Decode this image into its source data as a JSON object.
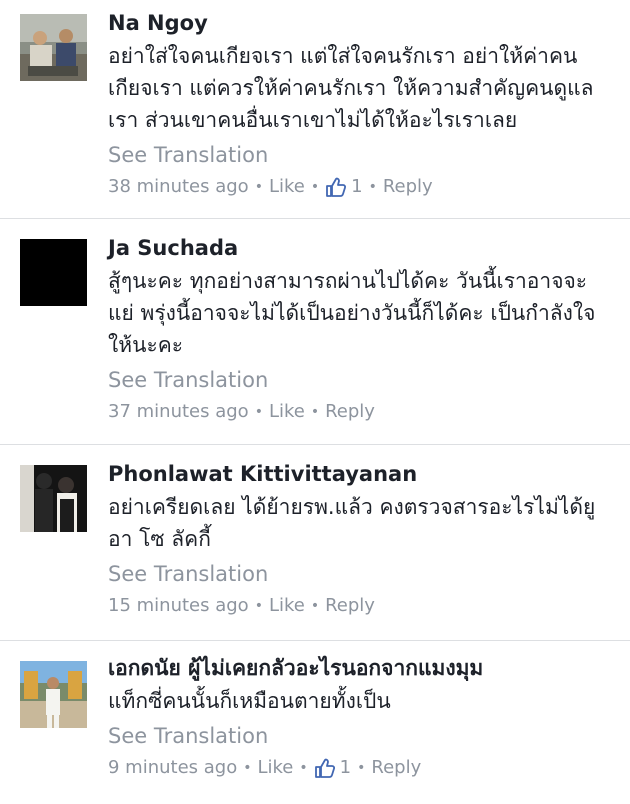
{
  "comments": [
    {
      "name": "Na Ngoy",
      "text": "อย่าใส่ใจคนเกียจเรา แต่ใส่ใจคนรักเรา อย่าให้ค่าคนเกียจเรา แต่ควรให้ค่าคนรักเรา ให้ความสำคัญคนดูแลเรา ส่วนเขาคนอื่นเราเขาไม่ได้ให้อะไรเราเลย",
      "see_translation": "See Translation",
      "time": "38 minutes ago",
      "like": "Like",
      "like_count": "1",
      "reply": "Reply"
    },
    {
      "name": "Ja Suchada",
      "text": "สู้ๆนะคะ ทุกอย่างสามารถผ่านไปได้คะ วันนี้เราอาจจะแย่ พรุ่งนี้อาจจะไม่ได้เป็นอย่างวันนี้ก็ได้คะ เป็นกำลังใจให้นะคะ",
      "see_translation": "See Translation",
      "time": "37 minutes ago",
      "like": "Like",
      "reply": "Reply"
    },
    {
      "name": "Phonlawat Kittivittayanan",
      "text": "อย่าเครียดเลย ได้ย้ายรพ.แล้ว คงตรวจสารอะไรไม่ได้ยู อา โซ ลัคกี้",
      "see_translation": "See Translation",
      "time": "15 minutes ago",
      "like": "Like",
      "reply": "Reply"
    },
    {
      "name": "เอกดนัย ผู้ไม่เคยกลัวอะไรนอกจากแมงมุม",
      "text": "แท็กซี่คนนั้นก็เหมือนตายทั้งเป็น",
      "see_translation": "See Translation",
      "time": "9 minutes ago",
      "like": "Like",
      "like_count": "1",
      "reply": "Reply"
    }
  ],
  "colors": {
    "name": "#1d2129",
    "meta": "#8d949e",
    "like_icon": "#4267b2",
    "divider": "#dddfe2"
  }
}
